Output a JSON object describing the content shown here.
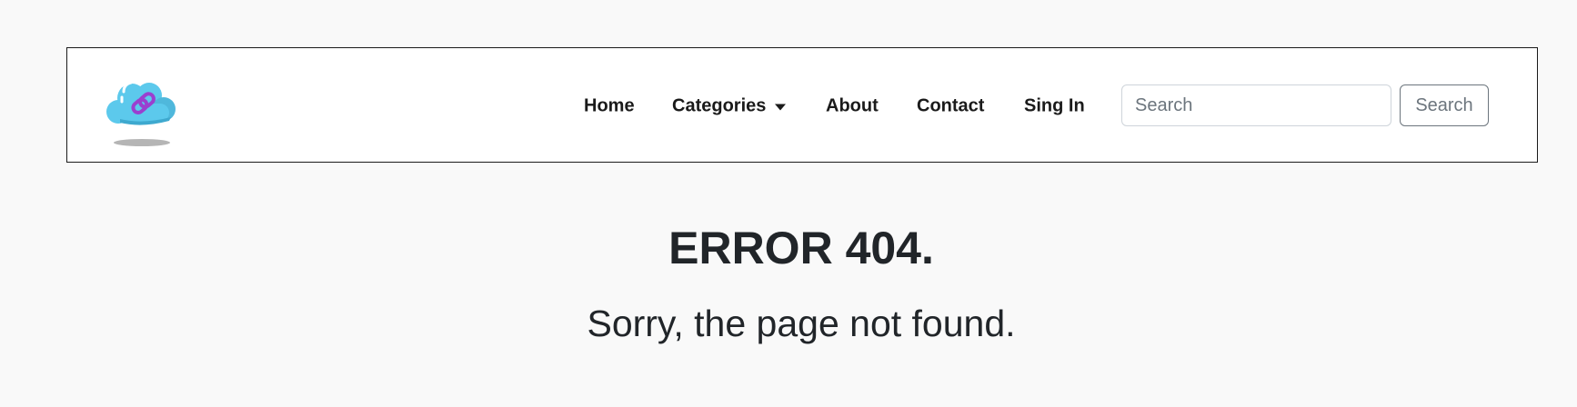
{
  "nav": {
    "logo_icon": "cloud-link-icon",
    "items": [
      {
        "label": "Home"
      },
      {
        "label": "Categories"
      },
      {
        "label": "About"
      },
      {
        "label": "Contact"
      },
      {
        "label": "Sing In"
      }
    ],
    "search_placeholder": "Search",
    "search_button": "Search"
  },
  "main": {
    "title": "ERROR 404.",
    "message": "Sorry, the page not found."
  },
  "colors": {
    "background": "#f9f9f9",
    "cloud": "#5cc9ec",
    "link": "#9b3fcf"
  }
}
